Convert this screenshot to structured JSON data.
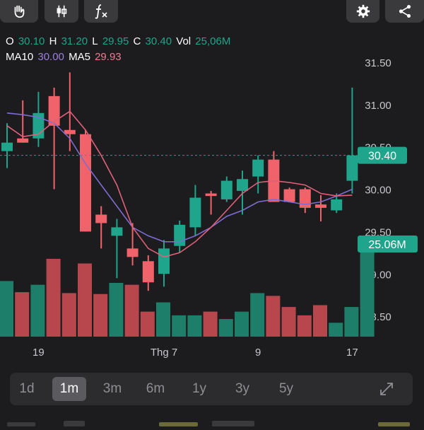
{
  "toolbar": {
    "left_icons": [
      "hand-icon",
      "candlestick-icon",
      "function-icon"
    ],
    "right_icons": [
      "gear-icon",
      "share-icon"
    ]
  },
  "ohlc": {
    "open_label": "O",
    "open": "30.10",
    "high_label": "H",
    "high": "31.20",
    "low_label": "L",
    "low": "29.95",
    "close_label": "C",
    "close": "30.40",
    "vol_label": "Vol",
    "vol": "25,06M"
  },
  "ma": {
    "ma10_label": "MA10",
    "ma10": "30.00",
    "ma5_label": "MA5",
    "ma5": "29.93"
  },
  "colors": {
    "up": "#1fa58b",
    "down": "#f0636a",
    "ma10": "#7f6bd0",
    "ma5": "#e0607a",
    "vol_up": "#1d7f6a",
    "vol_down": "#b8474d",
    "grid": "#3a3a3c",
    "axis_text": "#c7c7cc"
  },
  "chart_data": {
    "type": "candlestick",
    "y_ticks": [
      "31.50",
      "31.00",
      "30.50",
      "30.00",
      "29.50",
      "29.00",
      "28.50"
    ],
    "ylim": [
      28.3,
      31.68
    ],
    "x_labels": [
      {
        "label": "19",
        "index": 2
      },
      {
        "label": "Thg 7",
        "index": 10
      },
      {
        "label": "9",
        "index": 16
      },
      {
        "label": "17",
        "index": 22
      }
    ],
    "current_price_label": "30.40",
    "current_volume_label": "25.06M",
    "candles": [
      {
        "o": 30.45,
        "h": 30.78,
        "l": 30.25,
        "c": 30.55
      },
      {
        "o": 30.6,
        "h": 31.05,
        "l": 30.55,
        "c": 30.55
      },
      {
        "o": 30.6,
        "h": 31.15,
        "l": 30.5,
        "c": 30.9
      },
      {
        "o": 31.1,
        "h": 31.2,
        "l": 30.0,
        "c": 30.75
      },
      {
        "o": 30.7,
        "h": 31.38,
        "l": 30.45,
        "c": 30.65
      },
      {
        "o": 30.65,
        "h": 30.7,
        "l": 29.5,
        "c": 29.5
      },
      {
        "o": 29.7,
        "h": 29.8,
        "l": 29.3,
        "c": 29.6
      },
      {
        "o": 29.45,
        "h": 29.65,
        "l": 28.95,
        "c": 29.55
      },
      {
        "o": 29.3,
        "h": 29.6,
        "l": 29.1,
        "c": 29.2
      },
      {
        "o": 29.15,
        "h": 29.22,
        "l": 28.8,
        "c": 28.9
      },
      {
        "o": 29.0,
        "h": 29.4,
        "l": 28.85,
        "c": 29.3
      },
      {
        "o": 29.33,
        "h": 29.63,
        "l": 29.25,
        "c": 29.58
      },
      {
        "o": 29.55,
        "h": 30.05,
        "l": 29.45,
        "c": 29.9
      },
      {
        "o": 29.95,
        "h": 29.98,
        "l": 29.7,
        "c": 29.92
      },
      {
        "o": 29.88,
        "h": 30.15,
        "l": 29.85,
        "c": 30.1
      },
      {
        "o": 29.98,
        "h": 30.22,
        "l": 29.7,
        "c": 30.12
      },
      {
        "o": 30.15,
        "h": 30.4,
        "l": 29.95,
        "c": 30.35
      },
      {
        "o": 30.35,
        "h": 30.45,
        "l": 29.85,
        "c": 29.85
      },
      {
        "o": 30.0,
        "h": 30.02,
        "l": 29.85,
        "c": 29.85
      },
      {
        "o": 30.0,
        "h": 30.02,
        "l": 29.72,
        "c": 29.78
      },
      {
        "o": 29.82,
        "h": 29.93,
        "l": 29.62,
        "c": 29.78
      },
      {
        "o": 29.75,
        "h": 29.95,
        "l": 29.72,
        "c": 29.88
      },
      {
        "o": 30.1,
        "h": 31.2,
        "l": 29.95,
        "c": 30.4
      }
    ],
    "volume_rel": [
      0.6,
      0.48,
      0.56,
      0.84,
      0.47,
      0.79,
      0.46,
      0.58,
      0.56,
      0.27,
      0.37,
      0.23,
      0.23,
      0.27,
      0.19,
      0.27,
      0.47,
      0.44,
      0.32,
      0.23,
      0.34,
      0.15,
      0.32,
      1.0
    ],
    "ma10": [
      30.9,
      30.88,
      30.85,
      30.78,
      30.6,
      30.3,
      30.05,
      29.8,
      29.55,
      29.45,
      29.38,
      29.38,
      29.45,
      29.55,
      29.68,
      29.75,
      29.85,
      29.88,
      29.85,
      29.82,
      29.85,
      29.92,
      30.0
    ],
    "ma5": [
      30.75,
      30.62,
      30.65,
      30.8,
      30.92,
      30.7,
      30.4,
      30.05,
      29.55,
      29.3,
      29.2,
      29.25,
      29.38,
      29.55,
      29.75,
      29.95,
      30.08,
      30.1,
      30.08,
      30.05,
      29.95,
      29.92,
      29.93
    ]
  },
  "periods": [
    "1d",
    "1m",
    "3m",
    "6m",
    "1y",
    "3y",
    "5y"
  ],
  "active_period": "1m"
}
